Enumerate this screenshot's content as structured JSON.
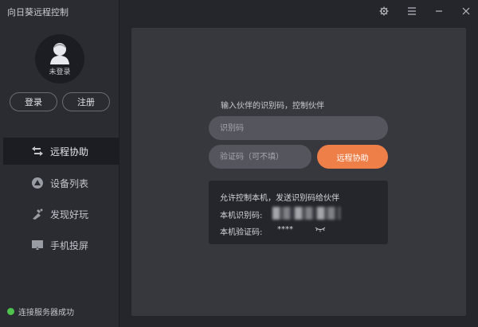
{
  "app": {
    "title": "向日葵远程控制"
  },
  "account": {
    "status": "未登录",
    "login_label": "登录",
    "register_label": "注册"
  },
  "nav": {
    "items": [
      {
        "label": "远程协助",
        "icon": "remote-assist-icon",
        "active": true
      },
      {
        "label": "设备列表",
        "icon": "device-list-icon",
        "active": false
      },
      {
        "label": "发现好玩",
        "icon": "discover-icon",
        "active": false
      },
      {
        "label": "手机投屏",
        "icon": "screen-mirror-icon",
        "active": false
      }
    ]
  },
  "status": {
    "text": "连接服务器成功",
    "color": "#4ec44e"
  },
  "main": {
    "prompt": "输入伙伴的识别码，控制伙伴",
    "id_placeholder": "识别码",
    "code_placeholder": "验证码（可不填）",
    "connect_label": "远程协助",
    "info": {
      "title": "允许控制本机，发送识别码给伙伴",
      "id_label": "本机识别码:",
      "code_label": "本机验证码:",
      "code_value": "****"
    }
  },
  "colors": {
    "accent": "#ef7f48",
    "sidebar_bg": "#2b2c32",
    "panel_bg": "#37383e"
  }
}
